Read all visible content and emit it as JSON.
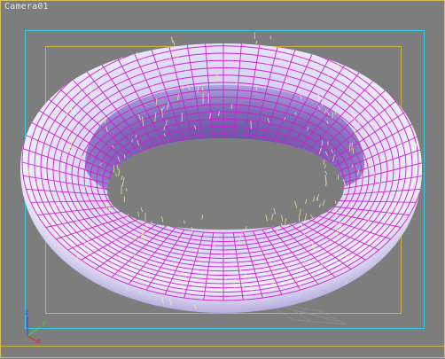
{
  "viewport": {
    "label": "Camera01"
  },
  "colors": {
    "background": "#7d7d7d",
    "safe_frame_outer": "#33c9e3",
    "safe_frame_inner": "#c9b43f",
    "wireframe": "#d21fd0",
    "hair": "#f4efa0",
    "axis_x": "#e22a2a",
    "axis_y": "#3bd63b",
    "axis_z": "#3a4de0"
  },
  "axis_gizmo": {
    "x_label": "x",
    "y_label": "y",
    "z_label": "z"
  }
}
